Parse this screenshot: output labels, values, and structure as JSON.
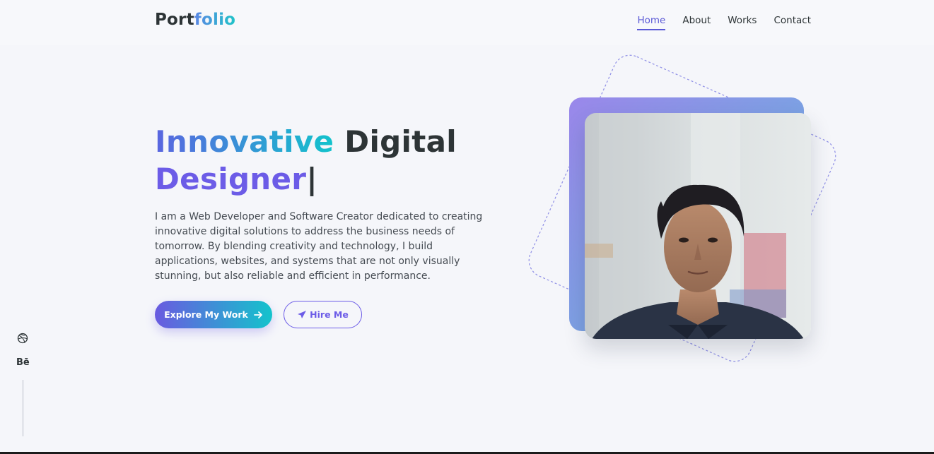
{
  "brand": {
    "logo_part1": "Port",
    "logo_part2": "folio"
  },
  "nav": {
    "items": [
      {
        "label": "Home",
        "active": true
      },
      {
        "label": "About",
        "active": false
      },
      {
        "label": "Works",
        "active": false
      },
      {
        "label": "Contact",
        "active": false
      }
    ]
  },
  "hero": {
    "title_word1": "Innovative",
    "title_word2": "Digital",
    "title_word3": "Designer",
    "cursor": "|",
    "description": "I am a Web Developer and Software Creator dedicated to creating innovative digital solutions to address the business needs of tomorrow. By blending creativity and technology, I build applications, websites, and systems that are not only visually stunning, but also reliable and efficient in performance.",
    "primary_button": "Explore My Work",
    "secondary_button": "Hire Me"
  },
  "social": {
    "behance": "Bē"
  },
  "icons": {
    "primary_button_icon": "arrow-right-icon",
    "secondary_button_icon": "paper-plane-icon",
    "social_1": "dribbble-icon",
    "social_2": "behance-icon"
  },
  "colors": {
    "accent_purple": "#6c5ce7",
    "accent_blue": "#5a65e0",
    "accent_teal": "#12c3cc",
    "text_dark": "#2d3436",
    "background": "#f5f6fa"
  }
}
